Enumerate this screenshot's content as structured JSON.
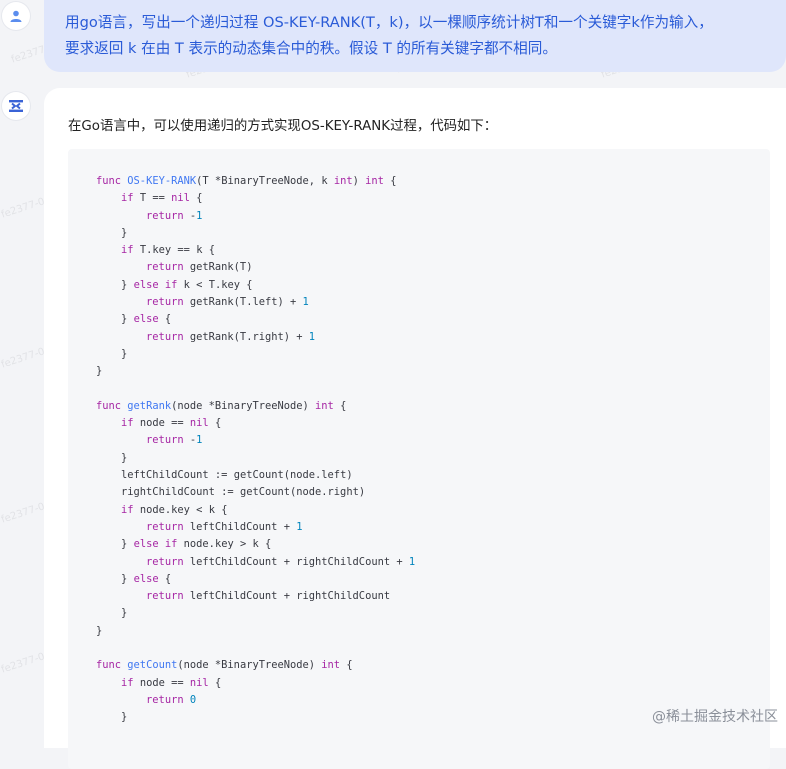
{
  "user_message": {
    "lines": [
      "用go语言，写出一个递归过程 OS-KEY-RANK(T，k)，以一棵顺序统计树T和一个关键字k作为输入，",
      "要求返回 k 在由 T 表示的动态集合中的秩。假设 T 的所有关键字都不相同。"
    ]
  },
  "bot_message": {
    "intro": "在Go语言中，可以使用递归的方式实现OS-KEY-RANK过程，代码如下：",
    "code_lines": [
      "func OS-KEY-RANK(T *BinaryTreeNode, k int) int {",
      "    if T == nil {",
      "        return -1",
      "    }",
      "    if T.key == k {",
      "        return getRank(T)",
      "    } else if k < T.key {",
      "        return getRank(T.left) + 1",
      "    } else {",
      "        return getRank(T.right) + 1",
      "    }",
      "}",
      "",
      "func getRank(node *BinaryTreeNode) int {",
      "    if node == nil {",
      "        return -1",
      "    }",
      "    leftChildCount := getCount(node.left)",
      "    rightChildCount := getCount(node.right)",
      "    if node.key < k {",
      "        return leftChildCount + 1",
      "    } else if node.key > k {",
      "        return leftChildCount + rightChildCount + 1",
      "    } else {",
      "        return leftChildCount + rightChildCount",
      "    }",
      "}",
      "",
      "func getCount(node *BinaryTreeNode) int {",
      "    if node == nil {",
      "        return 0",
      "    }"
    ]
  },
  "watermark_text": "fe2377-0065",
  "site_watermark": "@稀土掘金技术社区",
  "colors": {
    "user_bubble_bg": "#dfe6fb",
    "user_text": "#2a5bd7",
    "keyword": "#a626a4",
    "number": "#0184bc",
    "function_name": "#4078f2"
  },
  "icons": {
    "user_avatar": "person-icon",
    "bot_avatar": "bot-logo-icon"
  }
}
